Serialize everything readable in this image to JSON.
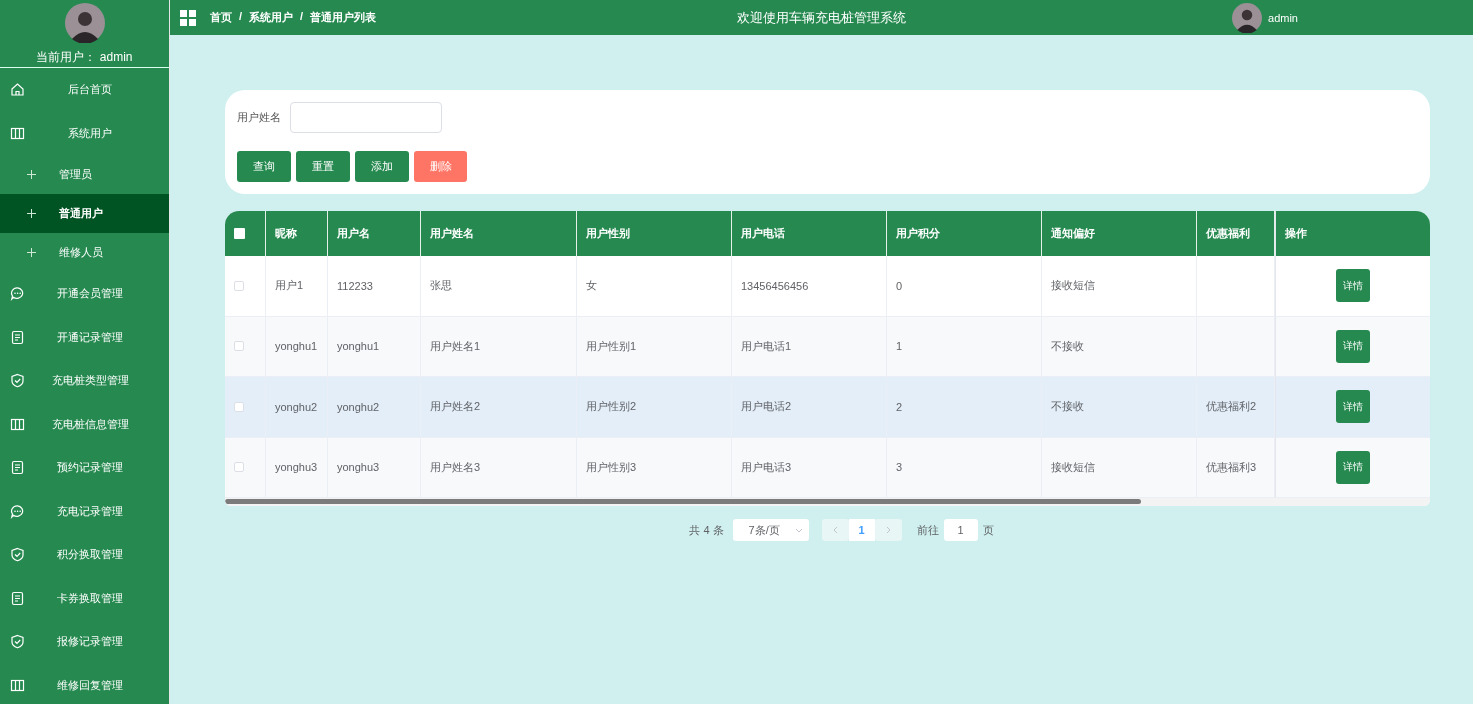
{
  "sidebar": {
    "current_user": "当前用户： admin",
    "menu": [
      {
        "label": "后台首页",
        "kind": "home",
        "selected": false
      },
      {
        "label": "系统用户",
        "kind": "columns",
        "selected": false,
        "children": [
          {
            "label": "管理员",
            "kind": "plus",
            "selected": false
          },
          {
            "label": "普通用户",
            "kind": "plus",
            "selected": true
          },
          {
            "label": "维修人员",
            "kind": "plus",
            "selected": false
          }
        ]
      },
      {
        "label": "开通会员管理",
        "kind": "chat",
        "selected": false
      },
      {
        "label": "开通记录管理",
        "kind": "doc",
        "selected": false
      },
      {
        "label": "充电桩类型管理",
        "kind": "shield",
        "selected": false
      },
      {
        "label": "充电桩信息管理",
        "kind": "columns",
        "selected": false
      },
      {
        "label": "预约记录管理",
        "kind": "doc",
        "selected": false
      },
      {
        "label": "充电记录管理",
        "kind": "chat",
        "selected": false
      },
      {
        "label": "积分换取管理",
        "kind": "shield",
        "selected": false
      },
      {
        "label": "卡券换取管理",
        "kind": "doc",
        "selected": false
      },
      {
        "label": "报修记录管理",
        "kind": "shield",
        "selected": false
      },
      {
        "label": "维修回复管理",
        "kind": "columns",
        "selected": false
      }
    ]
  },
  "header": {
    "breadcrumb": [
      "首页",
      "系统用户",
      "普通用户列表"
    ],
    "separator": "/",
    "title": "欢迎使用车辆充电桩管理系统",
    "user": "admin"
  },
  "search": {
    "label": "用户姓名",
    "buttons": [
      {
        "label": "查询",
        "kind": "primary"
      },
      {
        "label": "重置",
        "kind": "primary"
      },
      {
        "label": "添加",
        "kind": "primary"
      },
      {
        "label": "删除",
        "kind": "danger"
      }
    ]
  },
  "table": {
    "select_all_checked": false,
    "columns": [
      "昵称",
      "用户名",
      "用户姓名",
      "用户性别",
      "用户电话",
      "用户积分",
      "通知偏好",
      "优惠福利",
      "操作"
    ],
    "rows": [
      {
        "checked": false,
        "hovered": false,
        "cells": [
          "用户1",
          "112233",
          "张思",
          "女",
          "13456456456",
          "0",
          "接收短信",
          null
        ],
        "action": "详情"
      },
      {
        "checked": false,
        "hovered": false,
        "cells": [
          "yonghu1",
          "yonghu1",
          "用户姓名1",
          "用户性别1",
          "用户电话1",
          "1",
          "不接收",
          null
        ],
        "action": "详情"
      },
      {
        "checked": false,
        "hovered": true,
        "cells": [
          "yonghu2",
          "yonghu2",
          "用户姓名2",
          "用户性别2",
          "用户电话2",
          "2",
          "不接收",
          "优惠福利2"
        ],
        "action": "详情"
      },
      {
        "checked": false,
        "hovered": false,
        "cells": [
          "yonghu3",
          "yonghu3",
          "用户姓名3",
          "用户性别3",
          "用户电话3",
          "3",
          "接收短信",
          "优惠福利3"
        ],
        "action": "详情"
      }
    ]
  },
  "pagination": {
    "total": "共 4 条",
    "page_size": "7条/页",
    "pages": [
      {
        "label": "1",
        "selected": true
      }
    ],
    "goto_label": "前往",
    "goto_value": "1",
    "page_unit": "页"
  }
}
